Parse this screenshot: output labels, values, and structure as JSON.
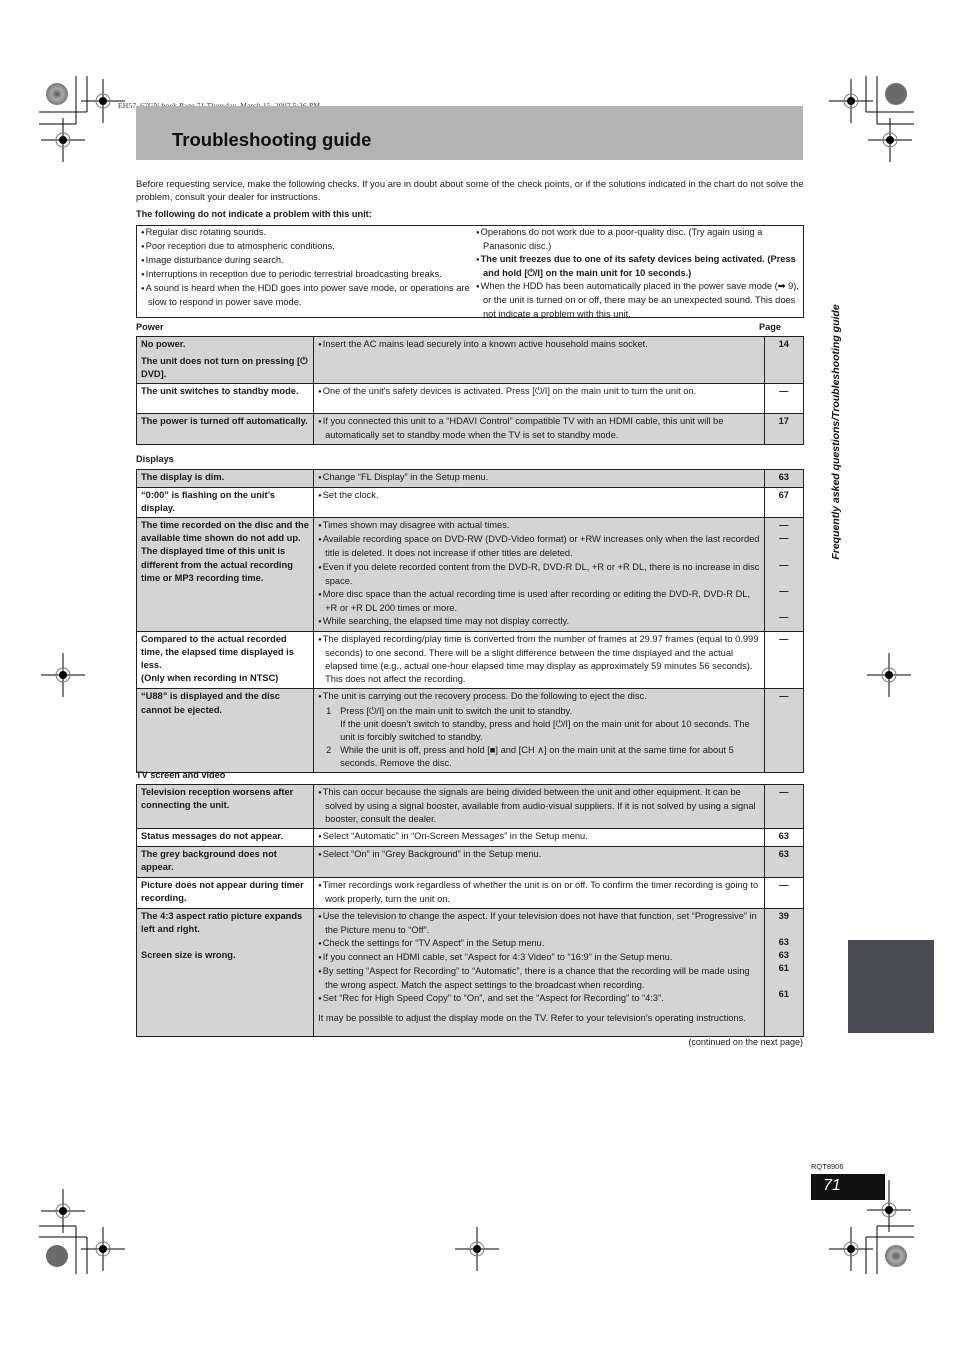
{
  "page_meta": {
    "print_header": "EH57_67GN.book  Page 71  Thursday, March 15, 2007  5:36 PM",
    "title": "Troubleshooting guide",
    "side_label": "Frequently asked questions/Troubleshooting guide",
    "doc_code": "RQT8906",
    "page_number": "71",
    "continued": "(continued on the next page)",
    "side_tab_color": "#4b4c51",
    "title_band_color": "#b3b3b3",
    "row_shade_color": "#d4d4d4"
  },
  "intro": {
    "text": "Before requesting service, make the following checks. If you are in doubt about some of the check points, or if the solutions indicated in the chart do not solve the problem, consult your dealer for instructions.",
    "not_problem_heading": "The following do not indicate a problem with this unit:",
    "not_problem_left": [
      "Regular disc rotating sounds.",
      "Poor reception due to atmospheric conditions.",
      "Image disturbance during search.",
      "Interruptions in reception due to periodic terrestrial broadcasting breaks.",
      "A sound is heard when the HDD goes into power save mode, or operations are slow to respond in power save mode."
    ],
    "not_problem_right": [
      "Operations do not work due to a poor-quality disc. (Try again using a Panasonic disc.)",
      "The unit freezes due to one of its safety devices being activated. (Press and hold [⏻/I] on the main unit for 10 seconds.)",
      "When the HDD has been automatically placed in the power save mode (➡ 9), or the unit is turned on or off, there may be an unexpected sound. This does not indicate a problem with this unit."
    ]
  },
  "sections": {
    "power": {
      "heading": "Power",
      "page_header": "Page",
      "rows": [
        {
          "problem": "No power.",
          "problem2": "The unit does not turn on pressing [⏻ DVD].",
          "solution": "Insert the AC mains lead securely into a known active household mains socket.",
          "page": "14"
        },
        {
          "problem": "The unit switches to standby mode.",
          "solution": "One of the unit's safety devices is activated. Press [⏻/I] on the main unit to turn the unit on.",
          "page": "—"
        },
        {
          "problem": "The power is turned off automatically.",
          "solution": "If you connected this unit to a “HDAVI Control” compatible TV with an HDMI cable, this unit will be automatically set to standby mode when the TV is set to standby mode.",
          "page": "17"
        }
      ]
    },
    "displays": {
      "heading": "Displays",
      "rows": [
        {
          "problem": "The display is dim.",
          "solution": "Change “FL Display” in the Setup menu.",
          "page": "63"
        },
        {
          "problem": "“0:00” is flashing on the unit’s display.",
          "solution": "Set the clock.",
          "page": "67"
        },
        {
          "problem": "The time recorded on the disc and the available time shown do not add up.",
          "problem2": "The displayed time of this unit is different from the actual recording time or MP3 recording time.",
          "solutions": [
            "Times shown may disagree with actual times.",
            "Available recording space on DVD-RW (DVD-Video format) or +RW increases only when the last recorded title is deleted. It does not increase if other titles are deleted.",
            "Even if you delete recorded content from the DVD-R, DVD-R DL, +R or +R DL, there is no increase in disc space.",
            "More disc space than the actual recording time is used after recording or editing the DVD-R, DVD-R DL, +R or +R DL 200 times or more.",
            "While searching, the elapsed time may not display correctly."
          ],
          "pages": [
            "—",
            "—",
            "—",
            "—",
            "—"
          ]
        },
        {
          "problem": "Compared to the actual recorded time, the elapsed time displayed is less.",
          "problem2": "(Only when recording in NTSC)",
          "solution": "The displayed recording/play time is converted from the number of frames at 29.97 frames (equal to 0.999 seconds) to one second. There will be a slight difference between the time displayed and the actual elapsed time (e.g., actual one-hour elapsed time may display as approximately 59 minutes 56 seconds). This does not affect the recording.",
          "page": "—"
        },
        {
          "problem": "“U88” is displayed and the disc cannot be ejected.",
          "solution": "The unit is carrying out the recovery process. Do the following to eject the disc.",
          "step1_num": "1",
          "step1": "Press [⏻/I] on the main unit to switch the unit to standby.",
          "step1_cont": "If the unit doesn’t switch to standby, press and hold [⏻/I] on the main unit for about 10 seconds. The unit is forcibly switched to standby.",
          "step2_num": "2",
          "step2": "While the unit is off, press and hold [■] and [CH ∧] on the main unit at the same time for about 5 seconds. Remove the disc.",
          "page": "—"
        }
      ]
    },
    "tv": {
      "heading": "TV screen and video",
      "rows": [
        {
          "problem": "Television reception worsens after connecting the unit.",
          "solution": "This can occur because the signals are being divided between the unit and other equipment. It can be solved by using a signal booster, available from audio-visual suppliers. If it is not solved by using a signal booster, consult the dealer.",
          "page": "—"
        },
        {
          "problem": "Status messages do not appear.",
          "solution": "Select “Automatic” in “On-Screen Messages” in the Setup menu.",
          "page": "63"
        },
        {
          "problem": "The grey background does not appear.",
          "solution": "Select “On” in “Grey Background” in the Setup menu.",
          "page": "63"
        },
        {
          "problem": "Picture does not appear during timer recording.",
          "solution": "Timer recordings work regardless of whether the unit is on or off. To confirm the timer recording is going to work properly, turn the unit on.",
          "page": "—"
        },
        {
          "problem": "The 4:3 aspect ratio picture expands left and right.",
          "problem2": "Screen size is wrong.",
          "solutions": [
            "Use the television to change the aspect. If your television does not have that function, set “Progressive” in the Picture menu to “Off”.",
            "Check the settings for “TV Aspect” in the Setup menu.",
            "If you connect an HDMI cable, set “Aspect for 4:3 Video” to “16:9” in the Setup menu.",
            "By setting “Aspect for Recording” to “Automatic”, there is a chance that the recording will be made using the wrong aspect. Match the aspect settings to the broadcast when recording.",
            "Set “Rec for High Speed Copy” to “On”, and set the “Aspect for Recording” to “4:3”."
          ],
          "note": "It may be possible to adjust the display mode on the TV. Refer to your television’s operating instructions.",
          "pages": [
            "39",
            "63",
            "63",
            "61",
            "61"
          ]
        }
      ]
    }
  }
}
